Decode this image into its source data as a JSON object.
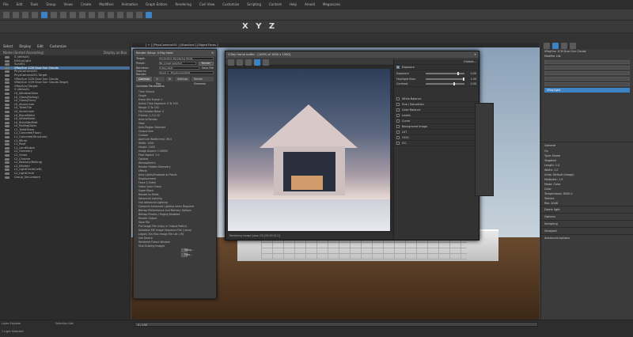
{
  "menubar": {
    "items": [
      "File",
      "Edit",
      "Tools",
      "Group",
      "Views",
      "Create",
      "Modifiers",
      "Animation",
      "Graph Editors",
      "Rendering",
      "Civil View",
      "Customize",
      "Scripting",
      "Content",
      "Help",
      "Arnold",
      "Megascans"
    ]
  },
  "axes": {
    "label": "X Y Z"
  },
  "viewport": {
    "label": "[ + ] [PhysCamera001 ] [Standard ] [Edged Faces ]"
  },
  "scene_explorer": {
    "tabs": [
      "Select",
      "Display",
      "Edit",
      "Customize"
    ],
    "header_name": "Name (Sorted Ascending)",
    "header_display": "Display as Box",
    "rows": [
      "0 (default)",
      "DirSunLight",
      "Sun001",
      "VRaySun 1CM Dual Sun Clouds",
      "PhysCamera001",
      "PhysCamera001.Target",
      "VRaySun 1CM Dual Sun Clouds",
      "VRaySun 1CM Dual Sun Clouds.Target",
      "VRaySun1Target",
      "0 (default)",
      "L0_WindowGlass",
      "L0_Glass(Railing)",
      "L0_Glass(Floor)",
      "L0_Aluminium",
      "L0_ToiletTile",
      "L0_Aluminium",
      "L0_BlackMetal",
      "L0_WhiteMetal",
      "L0_BrickWallMat",
      "L0_RailingGlass",
      "L1_ToiletGlass",
      "L1_Concrete(Floor)",
      "L1_Concrete(Structure)",
      "L1_Mirror",
      "L1_Roof",
      "L1_LandScape",
      "L2_Greenery",
      "L2_Grass",
      "L2_Chrome",
      "L2_Balcony(Railing)",
      "L2_Kitchen",
      "L2_LightCircle(Left)",
      "L2_LightCircle",
      "Group_Secundaire"
    ],
    "selected_index": 3
  },
  "render_setup": {
    "title": "Render Setup: V-Ray Next",
    "target_label": "Target:",
    "target_value": "Production Rendering Mode",
    "preset_label": "Preset:",
    "preset_value": "No preset selected",
    "renderer_label": "Renderer:",
    "renderer_value": "V-Ray Next",
    "save_file": "Save File",
    "view_label": "View to Render:",
    "view_value": "Quad 4 - PhysCamera001",
    "render_button": "Render",
    "tabs": [
      "Common",
      "V-Ray",
      "GI",
      "Settings",
      "Render Elements"
    ],
    "section": "Common Parameters",
    "lines": [
      "Time Output",
      "Single",
      "Every Nth Frame: 1",
      "Active Time Segment: 0 To 100",
      "Range: 0 To 100",
      "File Number Base: 0",
      "Frames: 1,3,5-12",
      "Area to Render",
      "View",
      "Auto Region Selected",
      "Output Size",
      "Custom",
      "Aperture Width(mm): 36.0",
      "Width: 1000",
      "Height: 1000",
      "Image Aspect: 1.00000",
      "Pixel Aspect: 1.0",
      "Options",
      "Atmospherics",
      "Render Hidden Geometry",
      "Effects",
      "Area Lights/Shadows as Points",
      "Displacement",
      "Force 2-Sided",
      "Video Color Check",
      "Super Black",
      "Render to Fields",
      "Advanced Lighting",
      "Use Advanced Lighting",
      "Compute Advanced Lighting when Required",
      "Bitmap Performance and Memory Options",
      "Bitmap Proxies / Paging Disabled",
      "Render Output",
      "Save File",
      "Put Image File List(s) in Output Path(s)",
      "Autodesk ME Image Sequence File (.imsq)",
      "Legacy 3ds Max Image File List (.ifl)",
      "Use Device",
      "Rendered Frame Window",
      "Skip Existing Images"
    ],
    "setup_btn": "Setup...",
    "files_btn": "Files..."
  },
  "vfb": {
    "title": "V-Ray frame buffer - [100% of 1000 x 1000]",
    "status": "Rendering image (pass 23) [00:00:52.2]",
    "globals": "Globals...",
    "exposure_label": "Exposure",
    "exposure_value": "0.00",
    "highlight_label": "Highlight Burn",
    "highlight_value": "1.00",
    "contrast_label": "Contrast",
    "contrast_value": "0.00",
    "corrections": [
      "White Balance",
      "Hue / Saturation",
      "Color Balance",
      "Levels",
      "Curve",
      "Background Image",
      "LUT",
      "OCIO",
      "ICC"
    ]
  },
  "command_panel": {
    "object_name": "VRaySun 1CM Dual Sun Clouds",
    "modifier_list": "Modifier List",
    "selected_item": "VRayLight",
    "rollouts": [
      "General",
      "Dome light",
      "Options",
      "Sampling",
      "Viewport",
      "Advanced options"
    ],
    "general_lines": [
      "On",
      "Type: Dome",
      "Targeted",
      "Length: 1.0",
      "Width: 1.0",
      "Units: Default (image)",
      "Multiplier: 1.0",
      "Mode: Color",
      "Color",
      "Temperature: 6500.0",
      "Texture",
      "Res: 2048"
    ]
  },
  "timeline": {
    "frame": "0 / 100",
    "status": "1 Light Selected",
    "layer": "Layer Explorer",
    "selection_set": "Selection Set:"
  }
}
